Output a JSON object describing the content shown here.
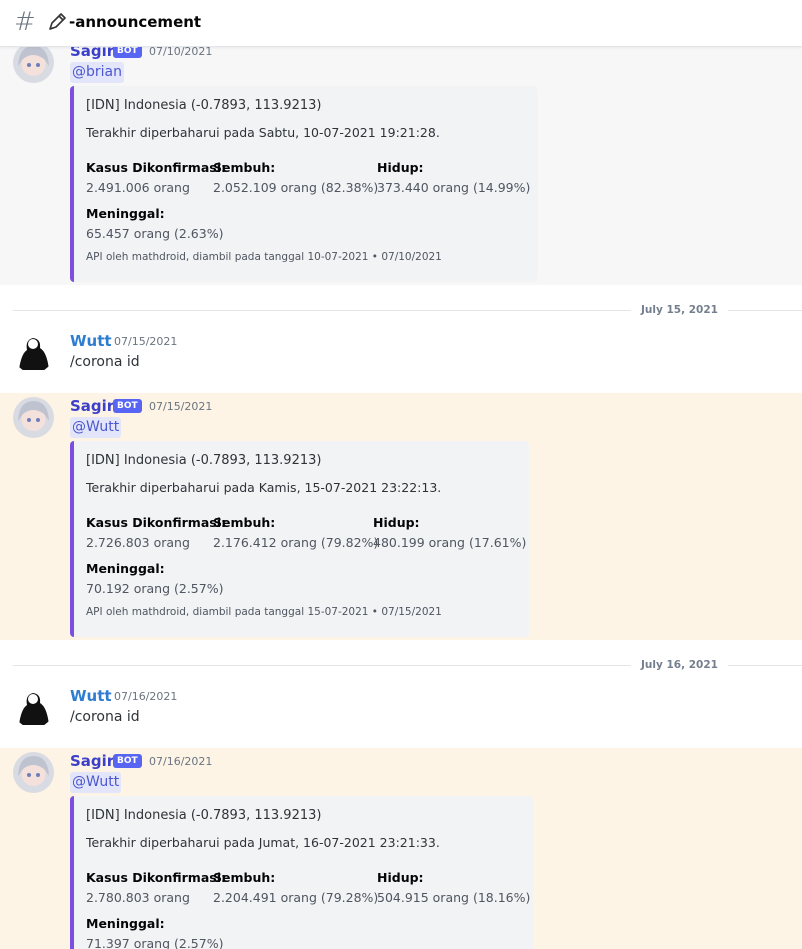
{
  "channel": {
    "name": "-announcement",
    "icon": "pencil-icon"
  },
  "colors": {
    "embed_bar": "#7c4fe0",
    "bot_tag": "#5865f2",
    "mention_bg": "#fdf4e6"
  },
  "dividers": [
    "July 15, 2021",
    "July 16, 2021"
  ],
  "messages": [
    {
      "author": "Sagiri",
      "bot_tag": "BOT",
      "timestamp": "07/10/2021",
      "mention": "@brian",
      "embed": {
        "title": "[IDN] Indonesia (-0.7893, 113.9213)",
        "description": "Terakhir diperbaharui pada Sabtu, 10-07-2021 19:21:28.",
        "fields": [
          {
            "name": "Kasus Dikonfirmasi:",
            "value": "2.491.006 orang"
          },
          {
            "name": "Sembuh:",
            "value": "2.052.109 orang (82.38%)"
          },
          {
            "name": "Hidup:",
            "value": "373.440 orang (14.99%)"
          },
          {
            "name": "Meninggal:",
            "value": "65.457 orang (2.63%)"
          }
        ],
        "footer": "API oleh mathdroid, diambil pada tanggal 10-07-2021 • 07/10/2021"
      }
    },
    {
      "author": "Wutt",
      "timestamp": "07/15/2021",
      "text": "/corona id"
    },
    {
      "author": "Sagiri",
      "bot_tag": "BOT",
      "timestamp": "07/15/2021",
      "mention": "@Wutt",
      "embed": {
        "title": "[IDN] Indonesia (-0.7893, 113.9213)",
        "description": "Terakhir diperbaharui pada Kamis, 15-07-2021 23:22:13.",
        "fields": [
          {
            "name": "Kasus Dikonfirmasi:",
            "value": "2.726.803 orang"
          },
          {
            "name": "Sembuh:",
            "value": "2.176.412 orang (79.82%)"
          },
          {
            "name": "Hidup:",
            "value": "480.199 orang (17.61%)"
          },
          {
            "name": "Meninggal:",
            "value": "70.192 orang (2.57%)"
          }
        ],
        "footer": "API oleh mathdroid, diambil pada tanggal 15-07-2021 • 07/15/2021"
      }
    },
    {
      "author": "Wutt",
      "timestamp": "07/16/2021",
      "text": "/corona id"
    },
    {
      "author": "Sagiri",
      "bot_tag": "BOT",
      "timestamp": "07/16/2021",
      "mention": "@Wutt",
      "embed": {
        "title": "[IDN] Indonesia (-0.7893, 113.9213)",
        "description": "Terakhir diperbaharui pada Jumat, 16-07-2021 23:21:33.",
        "fields": [
          {
            "name": "Kasus Dikonfirmasi:",
            "value": "2.780.803 orang"
          },
          {
            "name": "Sembuh:",
            "value": "2.204.491 orang (79.28%)"
          },
          {
            "name": "Hidup:",
            "value": "504.915 orang (18.16%)"
          },
          {
            "name": "Meninggal:",
            "value": "71.397 orang (2.57%)"
          }
        ]
      }
    }
  ]
}
